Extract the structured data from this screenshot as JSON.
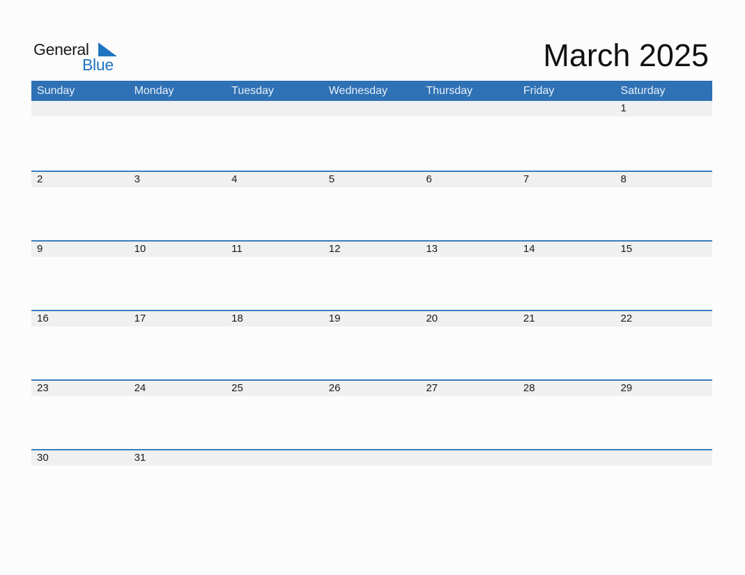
{
  "logo": {
    "line1": "General",
    "line2": "Blue"
  },
  "title": "March 2025",
  "colors": {
    "header_bg": "#2e71b4",
    "accent": "#1f74c0",
    "row_bg": "#f0f0f0"
  },
  "weekdays": [
    "Sunday",
    "Monday",
    "Tuesday",
    "Wednesday",
    "Thursday",
    "Friday",
    "Saturday"
  ],
  "weeks": [
    [
      "",
      "",
      "",
      "",
      "",
      "",
      "1"
    ],
    [
      "2",
      "3",
      "4",
      "5",
      "6",
      "7",
      "8"
    ],
    [
      "9",
      "10",
      "11",
      "12",
      "13",
      "14",
      "15"
    ],
    [
      "16",
      "17",
      "18",
      "19",
      "20",
      "21",
      "22"
    ],
    [
      "23",
      "24",
      "25",
      "26",
      "27",
      "28",
      "29"
    ],
    [
      "30",
      "31",
      "",
      "",
      "",
      "",
      ""
    ]
  ]
}
